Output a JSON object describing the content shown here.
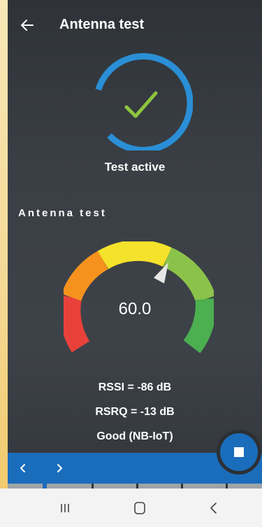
{
  "header": {
    "title": "Antenna test"
  },
  "status": {
    "text": "Test active"
  },
  "section": {
    "label": "Antenna test"
  },
  "gauge": {
    "value": "60.0",
    "level": 0.6
  },
  "metrics": {
    "rssi": "RSSI = -86 dB",
    "rsrq": "RSRQ = -13 dB",
    "quality": "Good (NB-IoT)"
  },
  "colors": {
    "accent": "#2a8fd6",
    "check": "#8cc63f",
    "gauge_red": "#e8413a",
    "gauge_orange": "#f5921e",
    "gauge_yellow": "#f5e22a",
    "gauge_lightgreen": "#8bc34a",
    "gauge_green": "#4caf50"
  },
  "icons": {
    "back": "arrow-left-icon",
    "prev": "chevron-left-icon",
    "next": "chevron-right-icon",
    "stop": "stop-icon"
  }
}
